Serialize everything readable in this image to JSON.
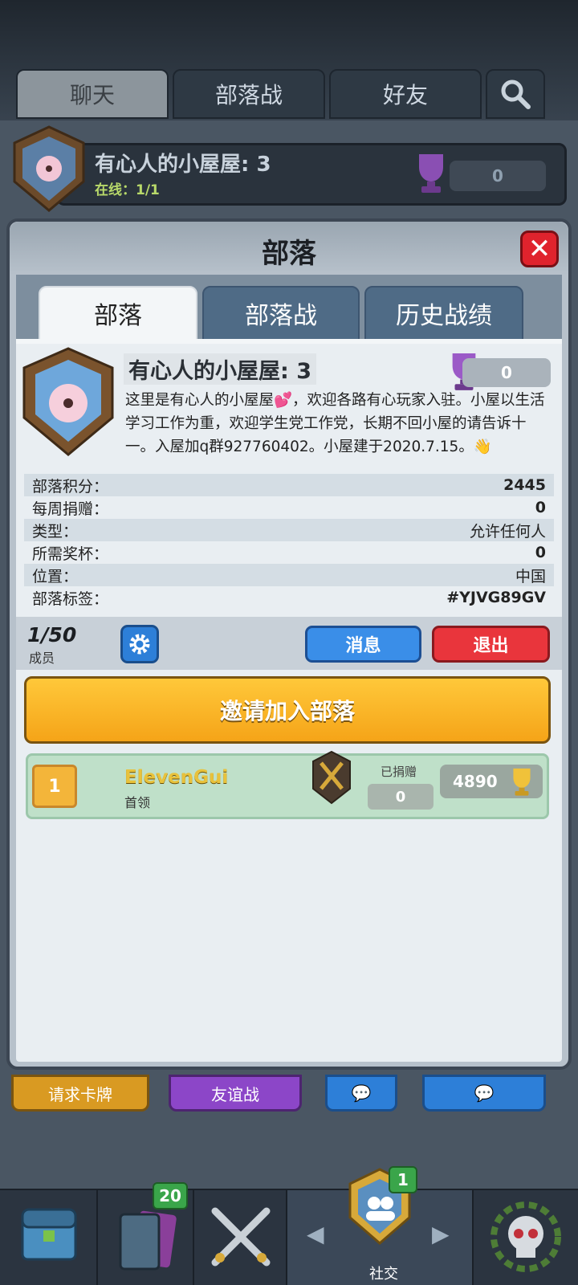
{
  "top_tabs": [
    {
      "label": "聊天",
      "active": true
    },
    {
      "label": "部落战",
      "active": false
    },
    {
      "label": "好友",
      "active": false
    }
  ],
  "banner": {
    "clan_name": "有心人的小屋屋: 3",
    "online": "在线：1/1",
    "trophies": "0"
  },
  "modal": {
    "title": "部落",
    "close_icon": "close-icon",
    "tabs": [
      {
        "label": "部落",
        "active": true
      },
      {
        "label": "部落战",
        "active": false
      },
      {
        "label": "历史战绩",
        "active": false
      }
    ]
  },
  "clan": {
    "name": "有心人的小屋屋: 3",
    "trophies": "0",
    "description": "这里是有心人的小屋屋💕，欢迎各路有心玩家入驻。小屋以生活学习工作为重，欢迎学生党工作党，长期不回小屋的请告诉十一。入屋加q群927760402。小屋建于2020.7.15。👋"
  },
  "info": [
    {
      "label": "部落积分：",
      "value": "2445"
    },
    {
      "label": "每周捐赠：",
      "value": "0"
    },
    {
      "label": "类型：",
      "value": "允许任何人"
    },
    {
      "label": "所需奖杯：",
      "value": "0"
    },
    {
      "label": "位置：",
      "value": "中国"
    },
    {
      "label": "部落标签：",
      "value": "#YJVG89GV"
    }
  ],
  "members_bar": {
    "count": "1/50",
    "label": "成员",
    "message_button": "消息",
    "exit_button": "退出"
  },
  "invite_button": "邀请加入部落",
  "members": [
    {
      "rank": "1",
      "name": "ElevenGui",
      "role": "首领",
      "donated_label": "已捐赠",
      "donated": "0",
      "trophies": "4890"
    }
  ],
  "behind_buttons": [
    "请求卡牌",
    "友谊战"
  ],
  "bottom_nav": {
    "cards_badge": "20",
    "social_badge": "1",
    "social_label": "社交"
  },
  "colors": {
    "accent_blue": "#3a8ee8",
    "exit_red": "#e9353c",
    "invite_orange": "#f5a418",
    "member_green": "#bfe0c9"
  }
}
